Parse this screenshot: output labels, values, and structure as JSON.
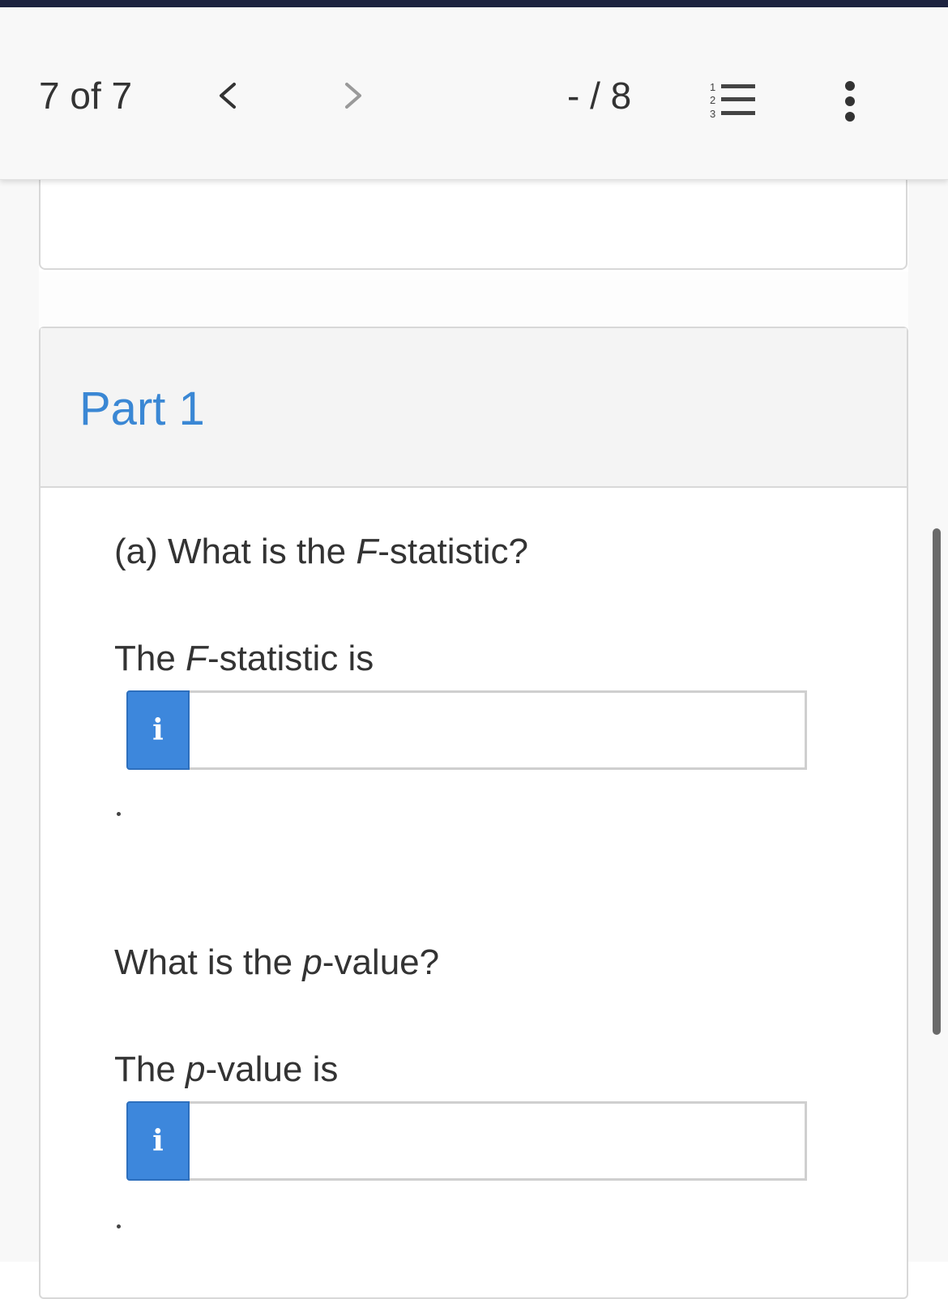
{
  "toolbar": {
    "counter": "7 of 7",
    "score": "- / 8",
    "prev_icon": "chevron-left-icon",
    "next_icon": "chevron-right-icon",
    "list_icon": "numbered-list-icon",
    "more_icon": "more-vertical-icon"
  },
  "part": {
    "title": "Part 1"
  },
  "questions": {
    "f_question": {
      "prefix": "(a) What is the ",
      "italic": "F",
      "suffix": "-statistic?"
    },
    "f_label": {
      "prefix": "The ",
      "italic": "F",
      "suffix": "-statistic is"
    },
    "f_input_value": "",
    "p_question": {
      "prefix": "What is the ",
      "italic": "p",
      "suffix": "-value?"
    },
    "p_label": {
      "prefix": "The ",
      "italic": "p",
      "suffix": "-value is"
    },
    "p_input_value": "",
    "info_glyph": "i",
    "period": "."
  },
  "colors": {
    "accent": "#3a87d4",
    "info_button": "#3d87dc",
    "top_strip": "#1d2340"
  }
}
